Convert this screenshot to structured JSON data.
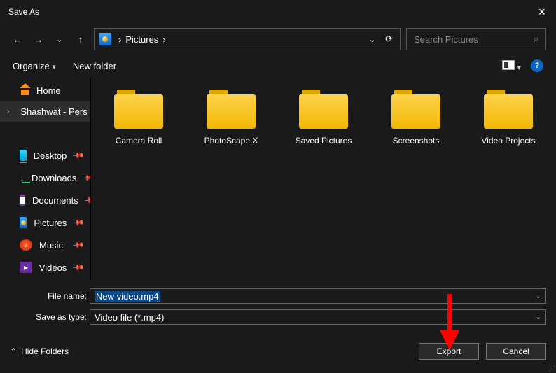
{
  "window": {
    "title": "Save As"
  },
  "breadcrumb": {
    "segment": "Pictures",
    "sep": "›"
  },
  "search": {
    "placeholder": "Search Pictures"
  },
  "toolbar": {
    "organize": "Organize",
    "newfolder": "New folder"
  },
  "tree": {
    "home": "Home",
    "onedrive": "Shashwat - Pers"
  },
  "quickaccess": [
    {
      "label": "Desktop",
      "icon": "desktop"
    },
    {
      "label": "Downloads",
      "icon": "dl"
    },
    {
      "label": "Documents",
      "icon": "doc"
    },
    {
      "label": "Pictures",
      "icon": "pic"
    },
    {
      "label": "Music",
      "icon": "music"
    },
    {
      "label": "Videos",
      "icon": "vid"
    }
  ],
  "folders": [
    "Camera Roll",
    "PhotoScape X",
    "Saved Pictures",
    "Screenshots",
    "Video Projects"
  ],
  "form": {
    "filename_label": "File name:",
    "filename_value": "New video.mp4",
    "type_label": "Save as type:",
    "type_value": "Video file (*.mp4)"
  },
  "buttons": {
    "hidefolders": "Hide Folders",
    "export": "Export",
    "cancel": "Cancel"
  }
}
